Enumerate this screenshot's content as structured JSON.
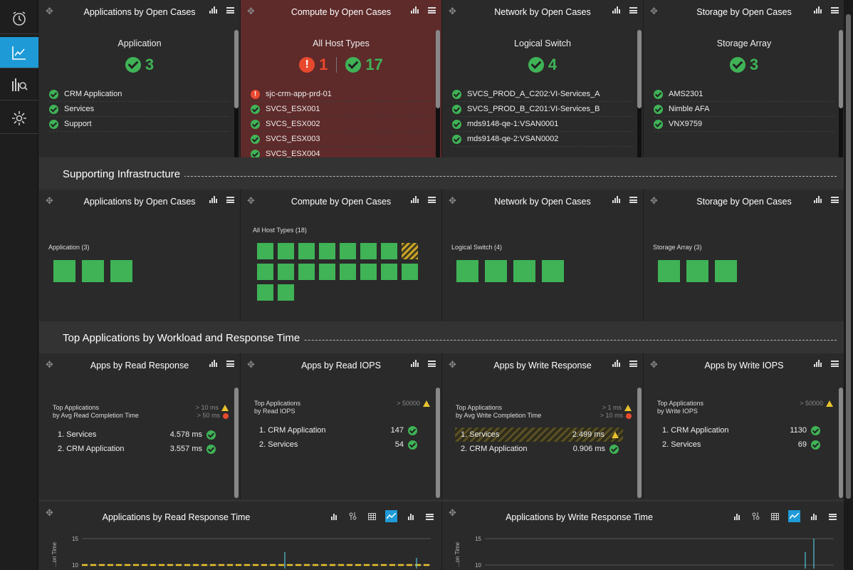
{
  "nav": {
    "items": [
      {
        "name": "alarm-clock-icon",
        "active": false
      },
      {
        "name": "line-chart-icon",
        "active": true
      },
      {
        "name": "chart-search-icon",
        "active": false
      },
      {
        "name": "gear-icon",
        "active": false
      }
    ]
  },
  "top_row": [
    {
      "title": "Applications by Open Cases",
      "type_label": "Application",
      "err": null,
      "ok": "3",
      "items": [
        {
          "s": "ok",
          "t": "CRM Application"
        },
        {
          "s": "ok",
          "t": "Services"
        },
        {
          "s": "ok",
          "t": "Support"
        }
      ]
    },
    {
      "title": "Compute by Open Cases",
      "type_label": "All Host Types",
      "err": "1",
      "ok": "17",
      "items": [
        {
          "s": "err",
          "t": "sjc-crm-app-prd-01"
        },
        {
          "s": "ok",
          "t": "SVCS_ESX001"
        },
        {
          "s": "ok",
          "t": "SVCS_ESX002"
        },
        {
          "s": "ok",
          "t": "SVCS_ESX003"
        },
        {
          "s": "ok",
          "t": "SVCS_ESX004"
        }
      ]
    },
    {
      "title": "Network by Open Cases",
      "type_label": "Logical Switch",
      "err": null,
      "ok": "4",
      "items": [
        {
          "s": "ok",
          "t": "SVCS_PROD_A_C202:VI-Services_A"
        },
        {
          "s": "ok",
          "t": "SVCS_PROD_B_C201:VI-Services_B"
        },
        {
          "s": "ok",
          "t": "mds9148-qe-1:VSAN0001"
        },
        {
          "s": "ok",
          "t": "mds9148-qe-2:VSAN0002"
        }
      ]
    },
    {
      "title": "Storage by Open Cases",
      "type_label": "Storage Array",
      "err": null,
      "ok": "3",
      "items": [
        {
          "s": "ok",
          "t": "AMS2301"
        },
        {
          "s": "ok",
          "t": "Nimble AFA"
        },
        {
          "s": "ok",
          "t": "VNX9759"
        }
      ]
    }
  ],
  "section1": "Supporting Infrastructure",
  "heatmap_row": [
    {
      "title": "Applications by Open Cases",
      "label": "Application (3)",
      "tiles": 3,
      "warn_index": -1
    },
    {
      "title": "Compute by Open Cases",
      "label": "All Host Types (18)",
      "tiles": 18,
      "warn_index": 7
    },
    {
      "title": "Network by Open Cases",
      "label": "Logical Switch (4)",
      "tiles": 4,
      "warn_index": -1
    },
    {
      "title": "Storage by Open Cases",
      "label": "Storage Array (3)",
      "tiles": 3,
      "warn_index": -1
    }
  ],
  "section2": "Top Applications by Workload and Response Time",
  "top_apps": [
    {
      "title": "Apps by Read Response",
      "sub1": "Top Applications",
      "sub2": "by Avg Read Completion Time",
      "thr1": "> 10 ms",
      "thr2": "> 50 ms",
      "rows": [
        {
          "n": "1. Services",
          "v": "4.578 ms",
          "warn": false
        },
        {
          "n": "2. CRM Application",
          "v": "3.557 ms",
          "warn": false
        }
      ]
    },
    {
      "title": "Apps by Read IOPS",
      "sub1": "Top Applications",
      "sub2": "by Read IOPS",
      "thr1": "> 50000",
      "thr2": null,
      "rows": [
        {
          "n": "1. CRM Application",
          "v": "147",
          "warn": false
        },
        {
          "n": "2. Services",
          "v": "54",
          "warn": false
        }
      ]
    },
    {
      "title": "Apps by Write Response",
      "sub1": "Top Applications",
      "sub2": "by Avg Write Completion Time",
      "thr1": "> 1 ms",
      "thr2": "> 10 ms",
      "rows": [
        {
          "n": "1. Services",
          "v": "2.499 ms",
          "warn": true
        },
        {
          "n": "2. CRM Application",
          "v": "0.906 ms",
          "warn": false
        }
      ]
    },
    {
      "title": "Apps by Write IOPS",
      "sub1": "Top Applications",
      "sub2": "by Write IOPS",
      "thr1": "> 50000",
      "thr2": null,
      "rows": [
        {
          "n": "1. CRM Application",
          "v": "1130",
          "warn": false
        },
        {
          "n": "2. Services",
          "v": "69",
          "warn": false
        }
      ]
    }
  ],
  "charts": [
    {
      "title": "Applications by Read Response Time",
      "ylabel": "...on Time",
      "yticks": [
        "15",
        "10"
      ],
      "threshold": 10
    },
    {
      "title": "Applications by Write Response Time",
      "ylabel": "...on Time",
      "yticks": [
        "15",
        "10"
      ],
      "threshold": null
    }
  ],
  "colors": {
    "ok": "#3fb356",
    "err": "#e8492e",
    "warn": "#e8c32e",
    "accent": "#1e9bd7",
    "alert_panel": "#5e2a2a"
  }
}
